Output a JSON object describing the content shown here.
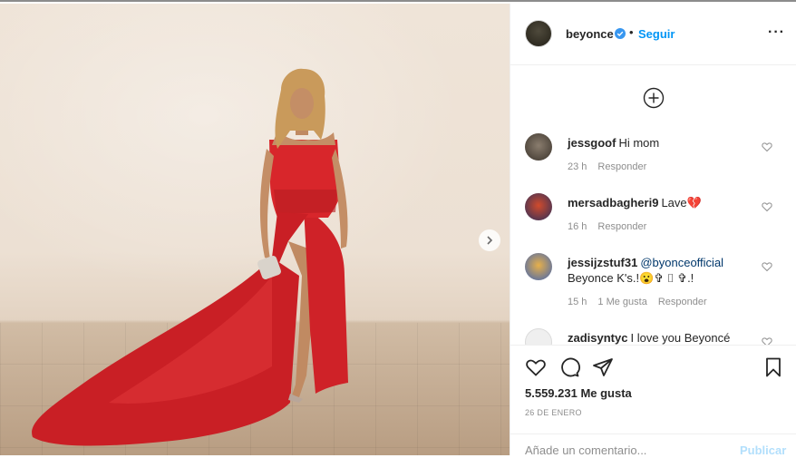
{
  "post": {
    "author": "beyonce",
    "follow_label": "Seguir",
    "separator": "•",
    "more_icon": "more-horizontal-icon",
    "verified_icon": "verified-badge-icon"
  },
  "comments": [
    {
      "user": "jessgoof",
      "text": "Hi mom",
      "time": "23 h",
      "likes": "",
      "reply": "Responder"
    },
    {
      "user": "mersadbagheri9",
      "text": "Lave💔",
      "time": "16 h",
      "likes": "",
      "reply": "Responder"
    },
    {
      "user": "jessijzstuf31",
      "mention": "@byonceofficial",
      "text": "Beyonce K's.!😮✞ ⌷ ✞.!",
      "time": "15 h",
      "likes": "1 Me gusta",
      "reply": "Responder"
    },
    {
      "user": "zadisyntyc",
      "text": "I love you Beyoncé"
    }
  ],
  "actions": {
    "likes": "5.559.231 Me gusta",
    "date": "26 DE ENERO"
  },
  "add_comment": {
    "placeholder": "Añade un comentario...",
    "publish_label": "Publicar"
  },
  "colors": {
    "accent": "#0095f6",
    "dress": "#d8262b",
    "publish_disabled": "#b2dffc"
  }
}
